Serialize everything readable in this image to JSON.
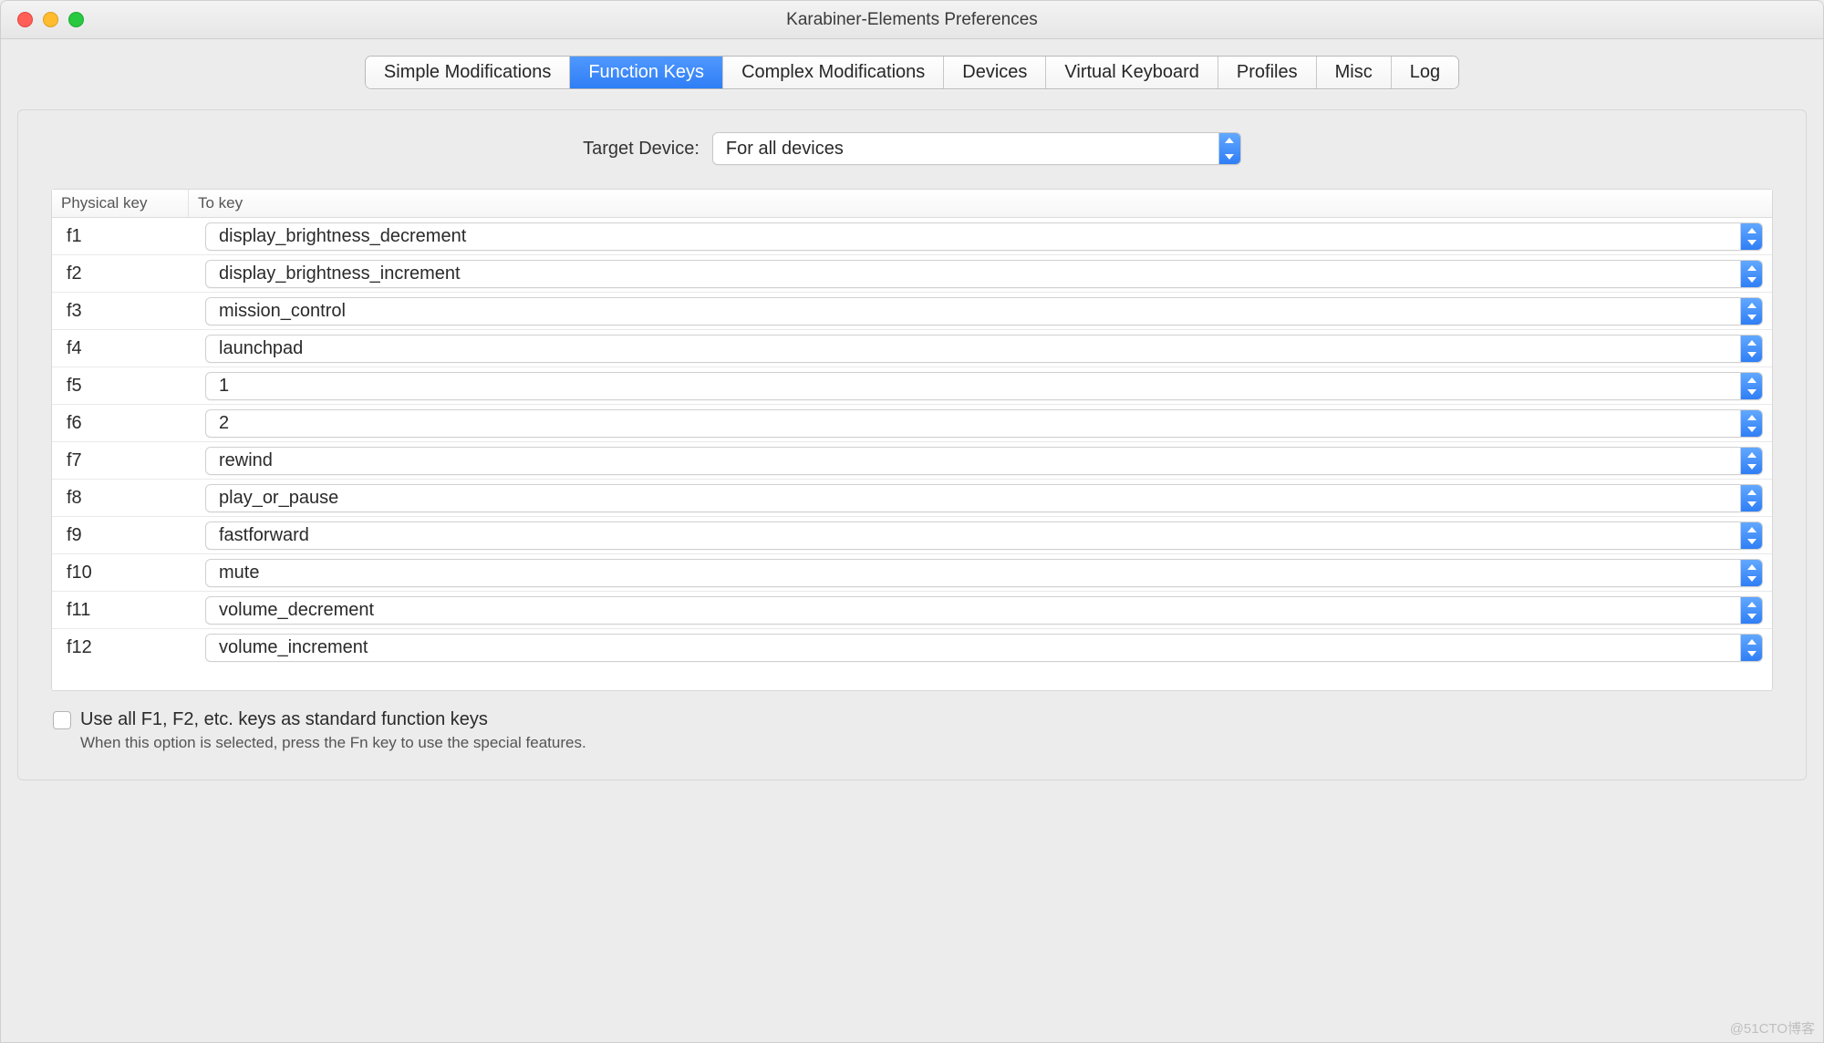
{
  "window": {
    "title": "Karabiner-Elements Preferences"
  },
  "tabs": [
    {
      "label": "Simple Modifications",
      "active": false
    },
    {
      "label": "Function Keys",
      "active": true
    },
    {
      "label": "Complex Modifications",
      "active": false
    },
    {
      "label": "Devices",
      "active": false
    },
    {
      "label": "Virtual Keyboard",
      "active": false
    },
    {
      "label": "Profiles",
      "active": false
    },
    {
      "label": "Misc",
      "active": false
    },
    {
      "label": "Log",
      "active": false
    }
  ],
  "target": {
    "label": "Target Device:",
    "selected": "For all devices"
  },
  "table": {
    "header_physical": "Physical key",
    "header_to": "To key",
    "rows": [
      {
        "key": "f1",
        "to": "display_brightness_decrement"
      },
      {
        "key": "f2",
        "to": "display_brightness_increment"
      },
      {
        "key": "f3",
        "to": "mission_control"
      },
      {
        "key": "f4",
        "to": "launchpad"
      },
      {
        "key": "f5",
        "to": "1"
      },
      {
        "key": "f6",
        "to": "2"
      },
      {
        "key": "f7",
        "to": "rewind"
      },
      {
        "key": "f8",
        "to": "play_or_pause"
      },
      {
        "key": "f9",
        "to": "fastforward"
      },
      {
        "key": "f10",
        "to": "mute"
      },
      {
        "key": "f11",
        "to": "volume_decrement"
      },
      {
        "key": "f12",
        "to": "volume_increment"
      }
    ]
  },
  "footer": {
    "checkbox_label": "Use all F1, F2, etc. keys as standard function keys",
    "hint": "When this option is selected, press the Fn key to use the special features."
  },
  "watermark": "@51CTO博客"
}
